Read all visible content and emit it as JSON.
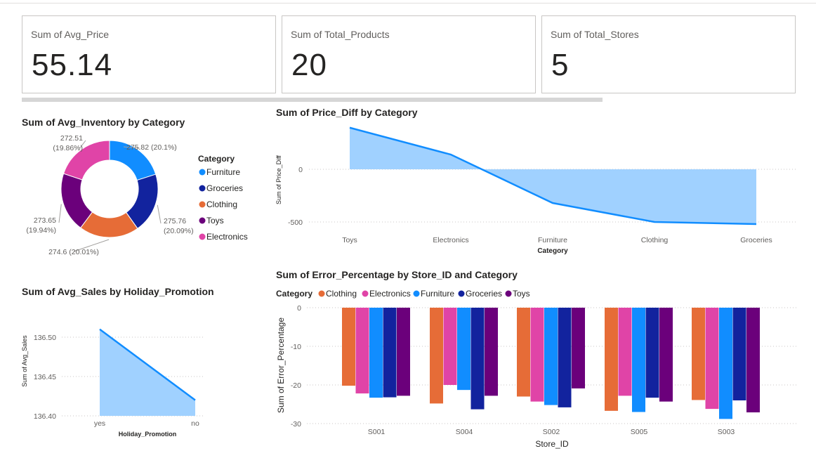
{
  "cards": [
    {
      "label": "Sum of Avg_Price",
      "value": "55.14"
    },
    {
      "label": "Sum of Total_Products",
      "value": "20"
    },
    {
      "label": "Sum of Total_Stores",
      "value": "5"
    }
  ],
  "colors": {
    "Furniture": "#118dff",
    "Groceries": "#12239e",
    "Clothing": "#e66c37",
    "Toys": "#6b007b",
    "Electronics": "#e044a7",
    "area_fill": "#a0d1ff",
    "area_line": "#118dff"
  },
  "chart_data": [
    {
      "type": "pie",
      "title": "Sum of Avg_Inventory by Category",
      "legend_title": "Category",
      "legend_placement": "right",
      "categories": [
        "Furniture",
        "Groceries",
        "Clothing",
        "Toys",
        "Electronics"
      ],
      "values": [
        275.82,
        275.76,
        274.6,
        273.65,
        272.51
      ],
      "data_labels": [
        {
          "value": "275.82",
          "pct": "(20.1%)"
        },
        {
          "value": "275.76",
          "pct": "(20.09%)"
        },
        {
          "value": "274.6",
          "pct": "(20.01%)"
        },
        {
          "value": "273.65",
          "pct": "(19.94%)"
        },
        {
          "value": "272.51",
          "pct": "(19.86%)"
        }
      ]
    },
    {
      "type": "area",
      "title": "Sum of Price_Diff by Category",
      "xlabel": "Category",
      "ylabel": "Sum of Price_Diff",
      "categories": [
        "Toys",
        "Electronics",
        "Furniture",
        "Clothing",
        "Groceries"
      ],
      "values": [
        395,
        140,
        -320,
        -500,
        -520
      ],
      "yticks": [
        "0",
        "-500"
      ],
      "ylim": [
        -560,
        400
      ],
      "grid": true
    },
    {
      "type": "area",
      "title": "Sum of Avg_Sales by Holiday_Promotion",
      "xlabel": "Holiday_Promotion",
      "ylabel": "Sum of Avg_Sales",
      "categories": [
        "yes",
        "no"
      ],
      "values": [
        136.51,
        136.42
      ],
      "yticks": [
        "136.50",
        "136.45",
        "136.40"
      ],
      "ylim": [
        136.39,
        136.53
      ],
      "grid": true
    },
    {
      "type": "bar",
      "title": "Sum of Error_Percentage by Store_ID and Category",
      "xlabel": "Store_ID",
      "ylabel": "Sum of Error_Percentage",
      "legend_title": "Category",
      "legend_placement": "top-left",
      "categories": [
        "S001",
        "S004",
        "S002",
        "S005",
        "S003"
      ],
      "series": [
        {
          "name": "Clothing",
          "values": [
            -20.2,
            -24.8,
            -23.0,
            -26.7,
            -23.9
          ]
        },
        {
          "name": "Electronics",
          "values": [
            -22.2,
            -20.0,
            -24.3,
            -22.8,
            -26.2
          ]
        },
        {
          "name": "Furniture",
          "values": [
            -23.3,
            -21.3,
            -25.2,
            -27.0,
            -28.8
          ]
        },
        {
          "name": "Groceries",
          "values": [
            -23.2,
            -26.3,
            -25.8,
            -23.3,
            -24.0
          ]
        },
        {
          "name": "Toys",
          "values": [
            -22.8,
            -22.8,
            -20.9,
            -24.3,
            -27.1
          ]
        }
      ],
      "yticks": [
        "0",
        "-10",
        "-20",
        "-30"
      ],
      "ylim": [
        -30,
        0
      ],
      "grid": true
    }
  ]
}
